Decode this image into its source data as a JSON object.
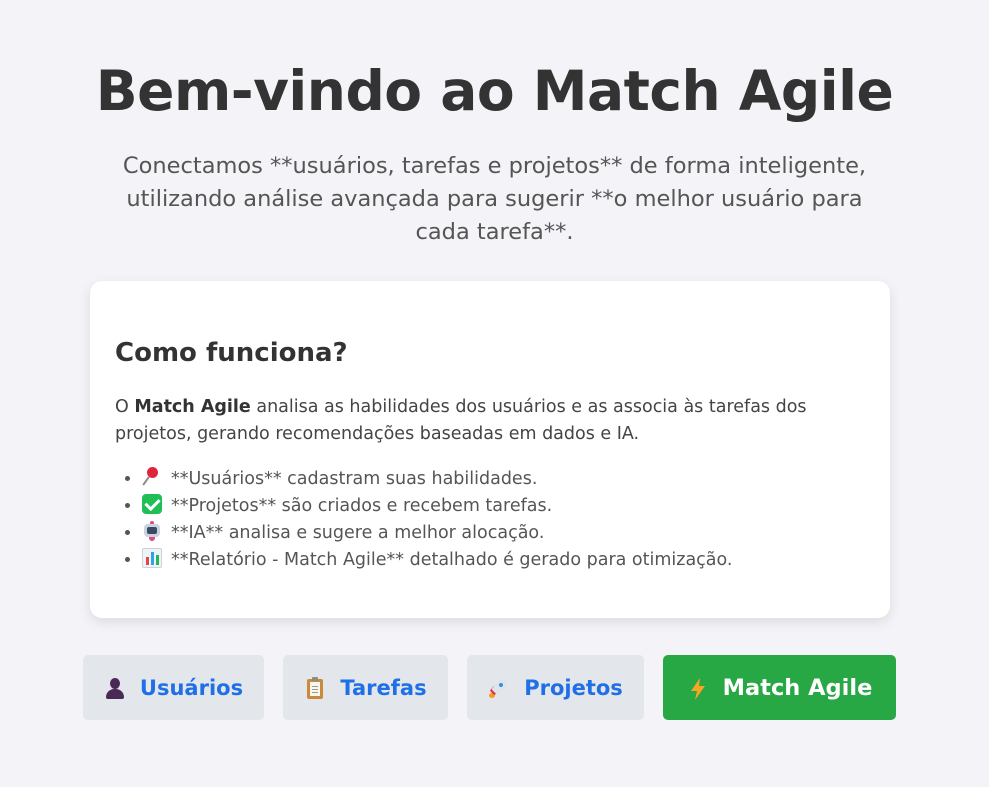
{
  "header": {
    "title": "Bem-vindo ao Match Agile",
    "intro": "Conectamos **usuários, tarefas e projetos** de forma inteligente, utilizando análise avançada para sugerir **o melhor usuário para cada tarefa**."
  },
  "card": {
    "title": "Como funciona?",
    "desc_prefix": "O ",
    "desc_brand": "Match Agile",
    "desc_suffix": " analisa as habilidades dos usuários e as associa às tarefas dos projetos, gerando recomendações baseadas em dados e IA.",
    "features": [
      {
        "icon": "pushpin-icon",
        "text": "**Usuários** cadastram suas habilidades."
      },
      {
        "icon": "check-mark-icon",
        "text": "**Projetos** são criados e recebem tarefas."
      },
      {
        "icon": "robot-icon",
        "text": "**IA** analisa e sugere a melhor alocação."
      },
      {
        "icon": "bar-chart-icon",
        "text": "**Relatório - Match Agile** detalhado é gerado para otimização."
      }
    ]
  },
  "nav": {
    "users": {
      "icon": "user-icon",
      "label": "Usuários"
    },
    "tasks": {
      "icon": "clipboard-icon",
      "label": "Tarefas"
    },
    "projects": {
      "icon": "rocket-icon",
      "label": "Projetos"
    },
    "match": {
      "icon": "lightning-icon",
      "label": "Match Agile"
    }
  },
  "colors": {
    "background": "#f4f4f8",
    "link_blue": "#1f6fe6",
    "secondary_button": "#e3e6ea",
    "primary_button": "#28a745"
  }
}
